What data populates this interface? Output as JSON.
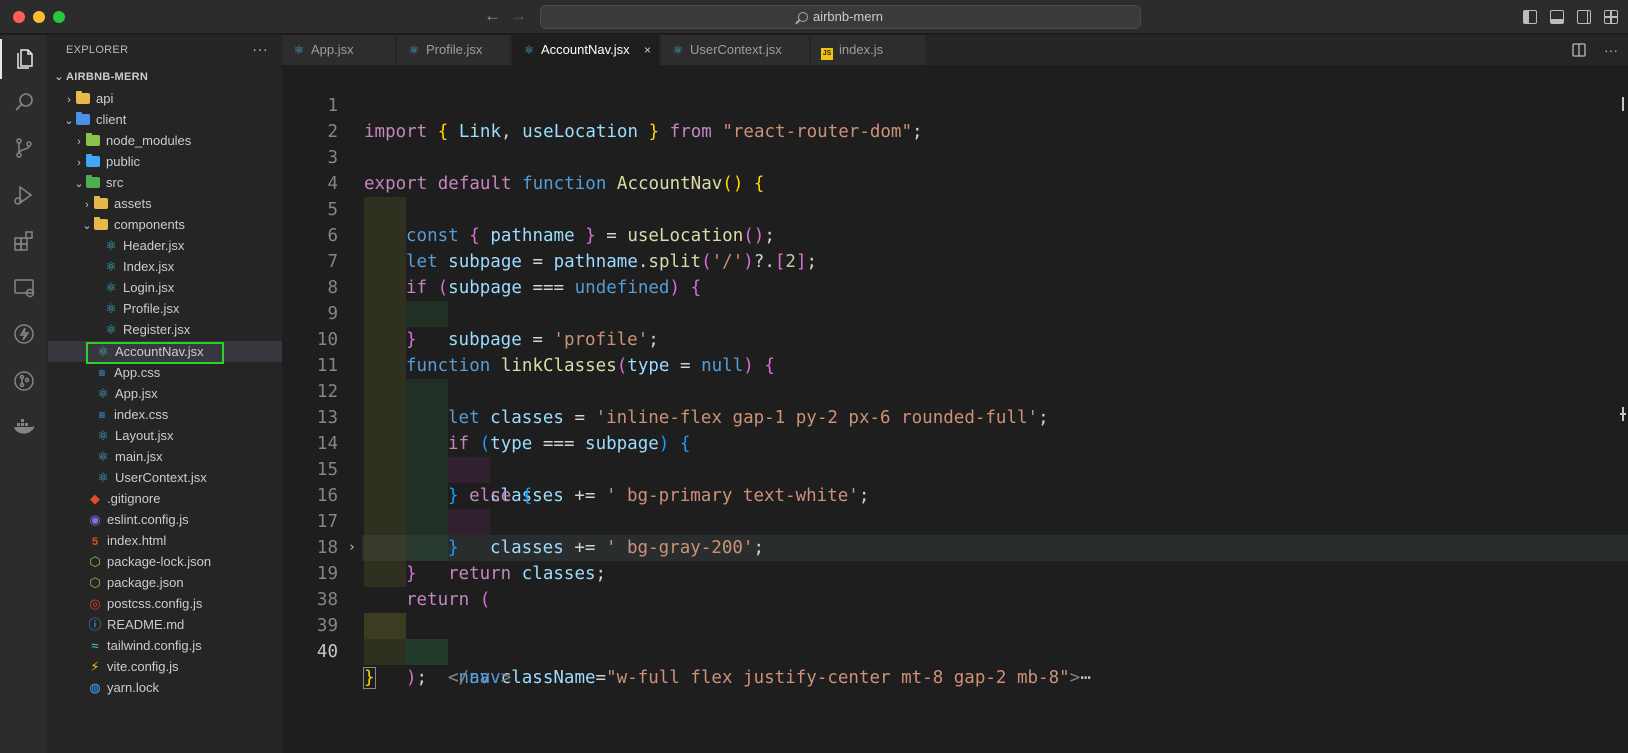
{
  "window": {
    "search_text": "airbnb-mern"
  },
  "sidebar": {
    "title": "EXPLORER",
    "more": "···",
    "root": "AIRBNB-MERN",
    "items": [
      {
        "label": "api"
      },
      {
        "label": "client"
      },
      {
        "label": "node_modules"
      },
      {
        "label": "public"
      },
      {
        "label": "src"
      },
      {
        "label": "assets"
      },
      {
        "label": "components"
      },
      {
        "label": "Header.jsx"
      },
      {
        "label": "Index.jsx"
      },
      {
        "label": "Login.jsx"
      },
      {
        "label": "Profile.jsx"
      },
      {
        "label": "Register.jsx"
      },
      {
        "label": "AccountNav.jsx"
      },
      {
        "label": "App.css"
      },
      {
        "label": "App.jsx"
      },
      {
        "label": "index.css"
      },
      {
        "label": "Layout.jsx"
      },
      {
        "label": "main.jsx"
      },
      {
        "label": "UserContext.jsx"
      },
      {
        "label": ".gitignore"
      },
      {
        "label": "eslint.config.js"
      },
      {
        "label": "index.html"
      },
      {
        "label": "package-lock.json"
      },
      {
        "label": "package.json"
      },
      {
        "label": "postcss.config.js"
      },
      {
        "label": "README.md"
      },
      {
        "label": "tailwind.config.js"
      },
      {
        "label": "vite.config.js"
      },
      {
        "label": "yarn.lock"
      }
    ]
  },
  "tabs": [
    {
      "label": "App.jsx"
    },
    {
      "label": "Profile.jsx"
    },
    {
      "label": "AccountNav.jsx"
    },
    {
      "label": "UserContext.jsx"
    },
    {
      "label": "index.js"
    }
  ],
  "tab_close": "×",
  "tab_more": "···",
  "js_badge": "JS",
  "editor": {
    "line_numbers": [
      "1",
      "2",
      "3",
      "4",
      "5",
      "6",
      "7",
      "8",
      "9",
      "10",
      "11",
      "12",
      "13",
      "14",
      "15",
      "16",
      "17",
      "18",
      "19",
      "38",
      "39",
      "40"
    ]
  },
  "colors": {
    "accent_highlight": "#2ad12a",
    "folder_yellow": "#e8b84a",
    "react_blue": "#3fb5d1"
  },
  "icons": {
    "activity": [
      "files-icon",
      "search-icon",
      "source-control-icon",
      "run-debug-icon",
      "extensions-icon",
      "remote-explorer-icon",
      "lightning-icon",
      "git-graph-icon",
      "docker-icon"
    ]
  }
}
